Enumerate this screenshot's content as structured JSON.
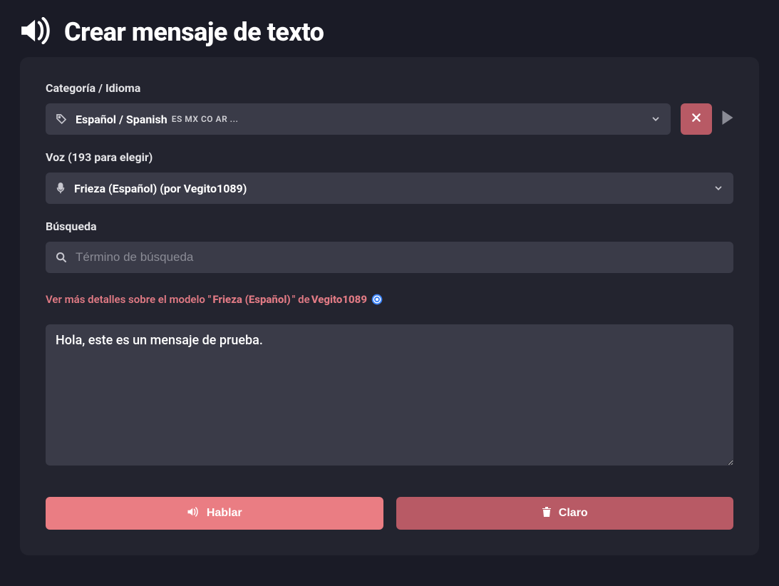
{
  "header": {
    "title": "Crear mensaje de texto"
  },
  "category": {
    "label": "Categoría / Idioma",
    "selected_main": "Español / Spanish",
    "selected_sub": "ES MX CO AR ..."
  },
  "voice": {
    "label": "Voz (193 para elegir)",
    "selected": "Frieza (Español) (por Vegito1089)"
  },
  "search": {
    "label": "Búsqueda",
    "placeholder": "Término de búsqueda"
  },
  "details": {
    "prefix": "Ver más detalles sobre el modelo \"",
    "model": "Frieza (Español)",
    "mid": "\" de ",
    "author": "Vegito1089"
  },
  "message": {
    "value": "Hola, este es un mensaje de prueba."
  },
  "buttons": {
    "speak": "Hablar",
    "clear": "Claro"
  }
}
